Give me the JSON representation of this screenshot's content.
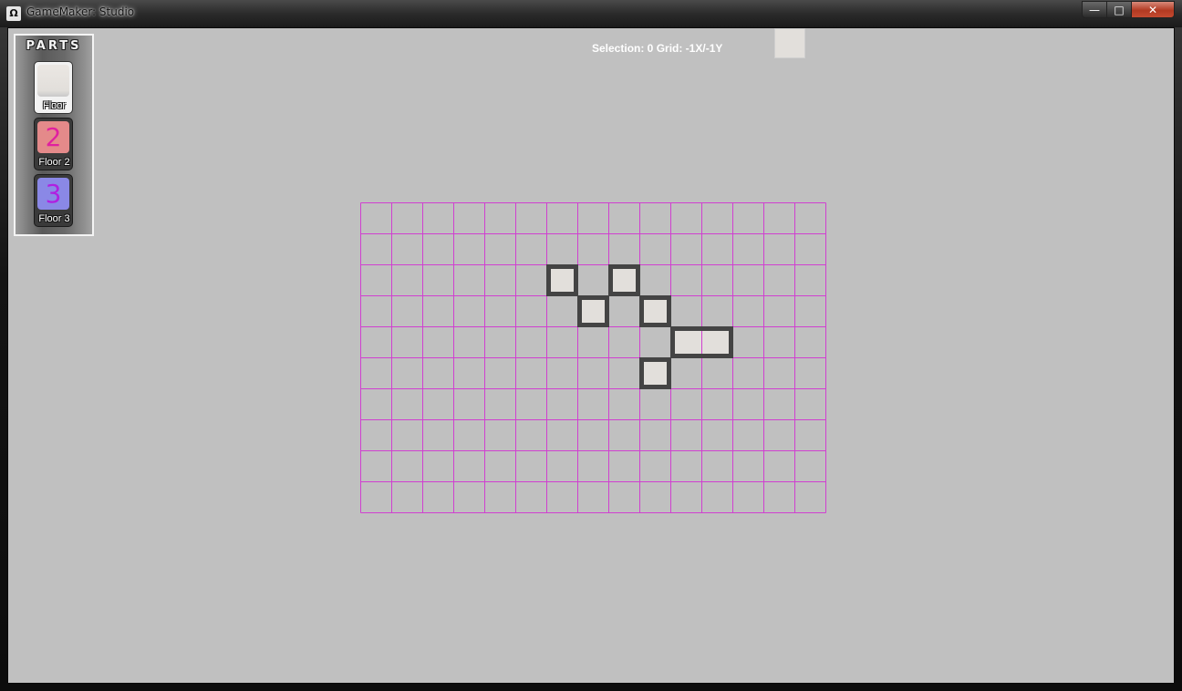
{
  "window": {
    "title": "GameMaker: Studio",
    "icon": "gamemaker-logo-icon",
    "icon_glyph": "Ω",
    "buttons": {
      "minimize": "—",
      "maximize": "□",
      "close": "✕"
    }
  },
  "parts_panel": {
    "title": "PARTS",
    "items": [
      {
        "label": "Floor",
        "selected": true,
        "color": "#e2dfdb",
        "digit": ""
      },
      {
        "label": "Floor 2",
        "selected": false,
        "color": "#e48a8a",
        "digit": "2"
      },
      {
        "label": "Floor 3",
        "selected": false,
        "color": "#8a88e6",
        "digit": "3"
      }
    ]
  },
  "status": {
    "text": "Selection: 0 Grid: -1X/-1Y"
  },
  "preview_tile": {
    "part": "Floor",
    "color": "#e2dfdb"
  },
  "grid": {
    "columns": 15,
    "rows": 10,
    "line_color": "#d040d0",
    "placed_tiles": [
      {
        "col": 6,
        "row": 2,
        "part": "Floor"
      },
      {
        "col": 8,
        "row": 2,
        "part": "Floor"
      },
      {
        "col": 7,
        "row": 3,
        "part": "Floor"
      },
      {
        "col": 9,
        "row": 3,
        "part": "Floor"
      },
      {
        "col": 10,
        "row": 4,
        "part": "Floor"
      },
      {
        "col": 11,
        "row": 4,
        "part": "Floor"
      },
      {
        "col": 9,
        "row": 5,
        "part": "Floor"
      }
    ]
  },
  "colors": {
    "workspace_bg": "#c0c0c0",
    "floor_tile": "#e2dfdb",
    "wall": "#444444"
  }
}
